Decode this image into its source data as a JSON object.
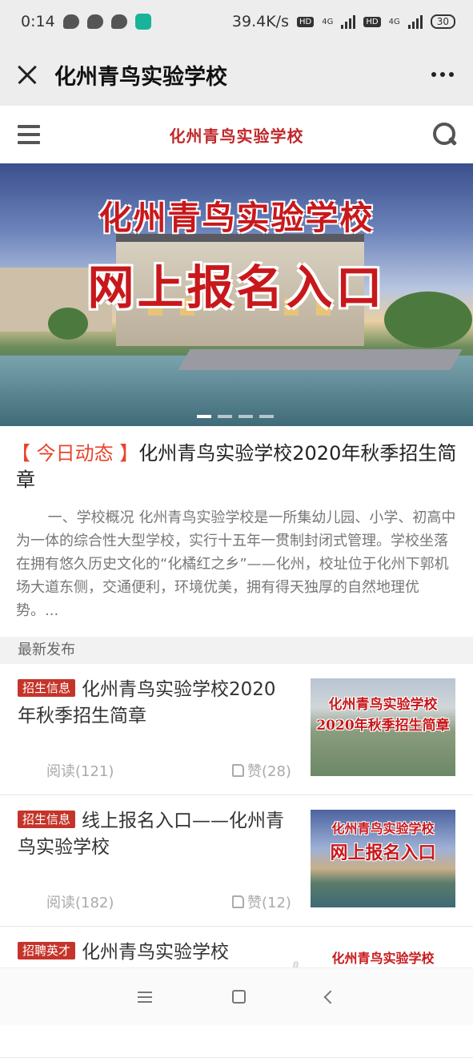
{
  "status_bar": {
    "time": "0:14",
    "speed": "39.4K/s",
    "hd1": "HD",
    "hd2": "HD",
    "net1": "4G",
    "net2": "4G",
    "battery": "30"
  },
  "title_bar": {
    "title": "化州青鸟实验学校"
  },
  "site_header": {
    "logo_text": "化州青鸟实验学校"
  },
  "banner": {
    "title": "化州青鸟实验学校",
    "subtitle": "网上报名入口",
    "slide_count": 4,
    "active_slide": 1
  },
  "today": {
    "tag": "【 今日动态 】",
    "title": "化州青鸟实验学校2020年秋季招生简章",
    "body": "一、学校概况 化州青鸟实验学校是一所集幼儿园、小学、初高中为一体的综合性大型学校，实行十五年一贯制封闭式管理。学校坐落在拥有悠久历史文化的“化橘红之乡”——化州，校址位于化州下郭机场大道东侧，交通便利，环境优美，拥有得天独厚的自然地理优势。..."
  },
  "section": {
    "latest_label": "最新发布"
  },
  "news": [
    {
      "badge": "招生信息",
      "title": "化州青鸟实验学校2020年秋季招生简章",
      "read": "阅读(121)",
      "like": "赞(28)",
      "img_line1": "化州青鸟实验学校",
      "img_line2": "2020年秋季招生简章"
    },
    {
      "badge": "招生信息",
      "title": "线上报名入口——化州青鸟实验学校",
      "read": "阅读(182)",
      "like": "赞(12)",
      "img_line1": "化州青鸟实验学校",
      "img_line2": "网上报名入口"
    },
    {
      "badge": "招聘英才",
      "title": "化州青鸟实验学校",
      "img_line1": "化州青鸟实验学校"
    }
  ],
  "watermark": "gdmm.com"
}
